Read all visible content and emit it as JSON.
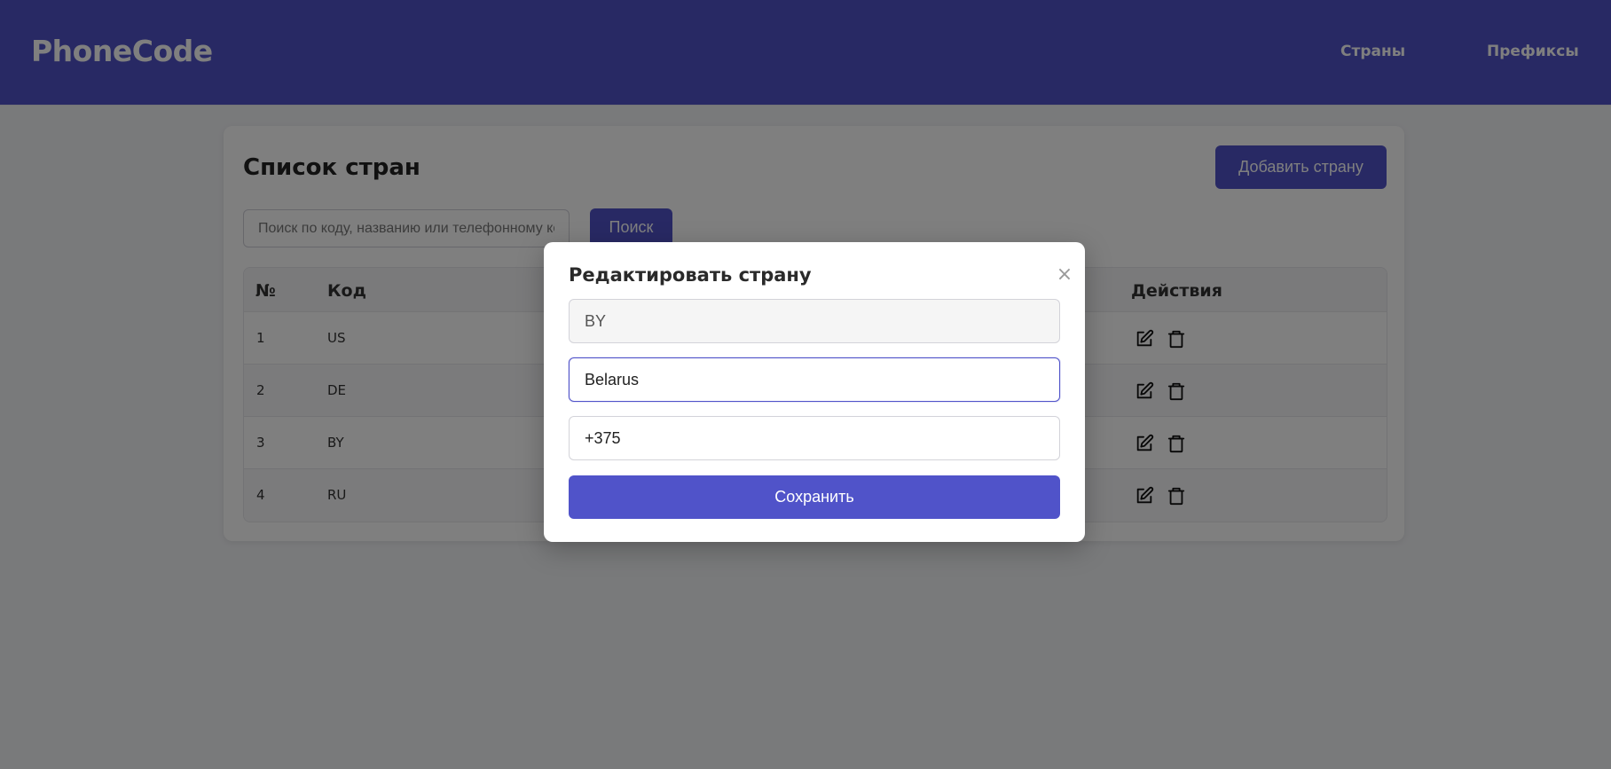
{
  "navbar": {
    "brand": "PhoneCode",
    "links": [
      {
        "label": "Страны"
      },
      {
        "label": "Префиксы"
      }
    ]
  },
  "page": {
    "title": "Список стран",
    "add_button": "Добавить страну",
    "search_placeholder": "Поиск по коду, названию или телефонному коду",
    "search_button": "Поиск"
  },
  "table": {
    "headers": {
      "num": "№",
      "code": "Код",
      "actions": "Действия"
    },
    "rows": [
      {
        "num": "1",
        "code": "US"
      },
      {
        "num": "2",
        "code": "DE"
      },
      {
        "num": "3",
        "code": "BY"
      },
      {
        "num": "4",
        "code": "RU"
      }
    ],
    "icons": {
      "edit": "edit-icon",
      "delete": "trash-icon"
    }
  },
  "modal": {
    "title": "Редактировать страну",
    "close": "×",
    "code_value": "BY",
    "name_value": "Belarus",
    "phone_value": "+375",
    "save_button": "Сохранить"
  },
  "colors": {
    "accent": "#5053c9",
    "overlay": "rgba(0,0,0,0.5)"
  }
}
